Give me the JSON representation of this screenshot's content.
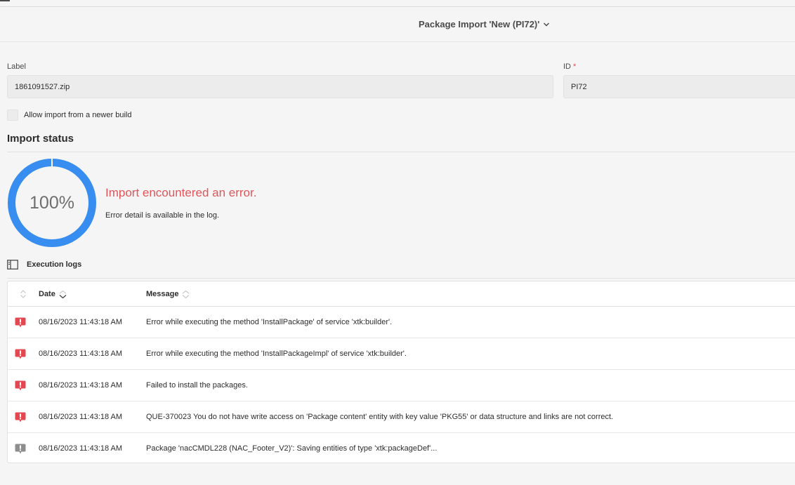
{
  "header": {
    "title": "Package Import 'New (PI72)'"
  },
  "form": {
    "label_caption": "Label",
    "label_value": "1861091527.zip",
    "id_caption": "ID",
    "id_required_mark": "*",
    "id_value": "PI72",
    "allow_newer_label": "Allow import from a newer build",
    "allow_newer_checked": false
  },
  "import_status": {
    "title": "Import status",
    "progress_percent": 100,
    "progress_label": "100%",
    "message": "Import encountered an error.",
    "detail": "Error detail is available in the log."
  },
  "logs": {
    "title": "Execution logs",
    "columns": {
      "date": "Date",
      "message": "Message"
    },
    "rows": [
      {
        "icon": "error-icon",
        "severity": "error",
        "date": "08/16/2023 11:43:18 AM",
        "message": "Error while executing the method 'InstallPackage' of service 'xtk:builder'."
      },
      {
        "icon": "error-icon",
        "severity": "error",
        "date": "08/16/2023 11:43:18 AM",
        "message": "Error while executing the method 'InstallPackageImpl' of service 'xtk:builder'."
      },
      {
        "icon": "error-icon",
        "severity": "error",
        "date": "08/16/2023 11:43:18 AM",
        "message": "Failed to install the packages."
      },
      {
        "icon": "error-icon",
        "severity": "error",
        "date": "08/16/2023 11:43:18 AM",
        "message": "QUE-370023 You do not have write access on 'Package content' entity with key value 'PKG55' or data structure and links are not correct."
      },
      {
        "icon": "info-icon",
        "severity": "info",
        "date": "08/16/2023 11:43:18 AM",
        "message": "Package 'nacCMDL228 (NAC_Footer_V2)': Saving entities of type 'xtk:packageDef'..."
      }
    ]
  },
  "colors": {
    "accent": "#378ef0",
    "error": "#e34850",
    "error_text": "#e0565b",
    "info": "#8e8e8e"
  }
}
